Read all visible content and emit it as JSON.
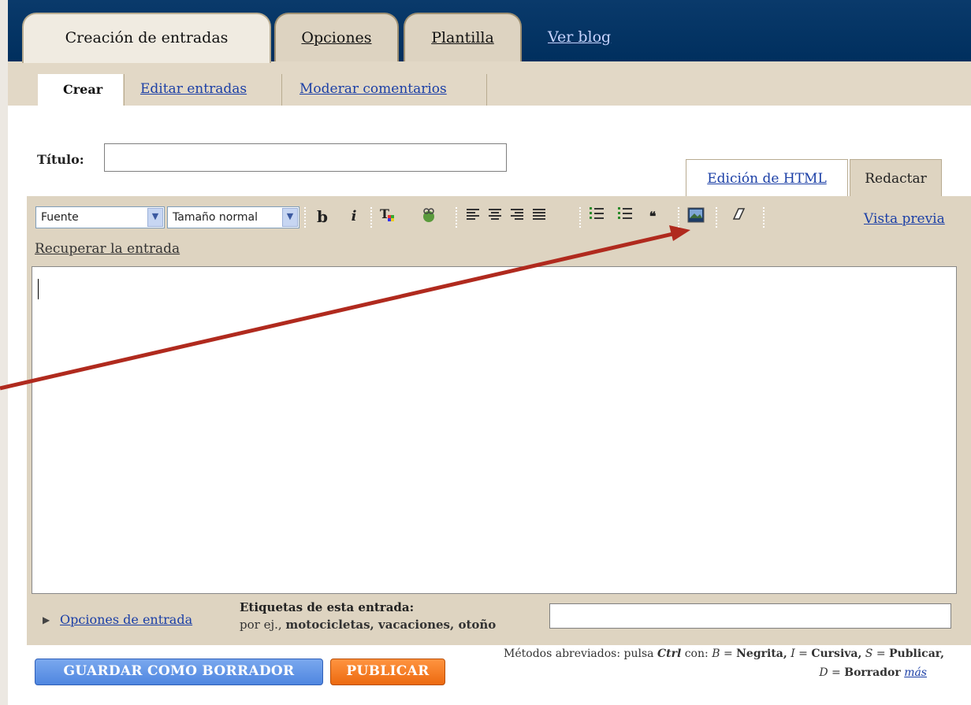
{
  "main_tabs": [
    {
      "label": "Creación de entradas",
      "active": true
    },
    {
      "label": "Opciones",
      "active": false
    },
    {
      "label": "Plantilla",
      "active": false
    }
  ],
  "view_blog": "Ver blog",
  "sub_tabs": [
    "Crear",
    "Editar entradas",
    "Moderar comentarios"
  ],
  "title_label": "Título:",
  "title_value": "",
  "mode_tabs": [
    "Edición de HTML",
    "Redactar"
  ],
  "toolbar": {
    "font_select": "Fuente",
    "size_select": "Tamaño normal",
    "bold": "b",
    "italic": "i",
    "preview": "Vista previa"
  },
  "recover": "Recuperar la entrada",
  "editor_value": "",
  "post_options": "Opciones de entrada",
  "labels_heading": "Etiquetas de esta entrada:",
  "labels_example_prefix": "por ej.,",
  "labels_example": "motocicletas, vacaciones, otoño",
  "labels_value": "",
  "save_draft": "GUARDAR COMO BORRADOR",
  "publish": "PUBLICAR",
  "shortcuts": {
    "prefix": "Métodos abreviados: pulsa",
    "ctrl": "Ctrl",
    "con": "con:",
    "b_key": "B",
    "b_label": "Negrita,",
    "i_key": "I",
    "i_label": "Cursiva,",
    "s_key": "S",
    "s_label": "Publicar,",
    "d_key": "D",
    "d_label": "Borrador",
    "more": "más",
    "eq": "="
  },
  "colors": {
    "navy": "#003366",
    "tan": "#ded4c1",
    "arrow": "#b02a1e",
    "save_btn": "#5a8fe6",
    "publish_btn": "#f0781e"
  }
}
